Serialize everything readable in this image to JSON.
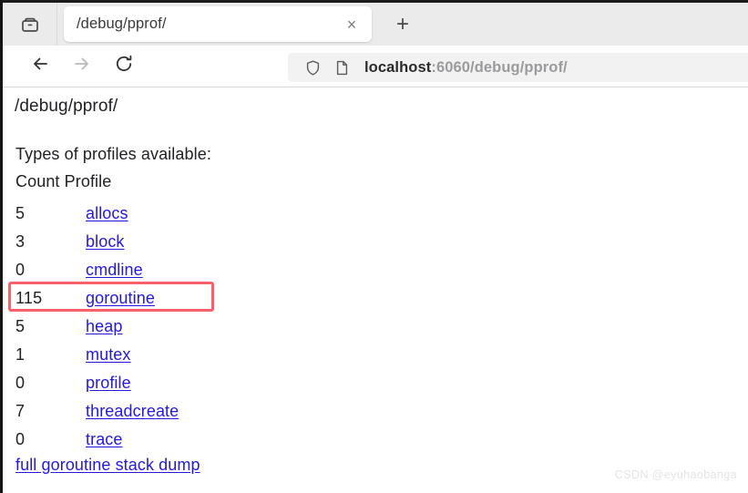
{
  "browser": {
    "tab_bar": {
      "list_all_tabs_icon": "tab-group-icon",
      "tabs": [
        {
          "title": "/debug/pprof/",
          "close_label": "×",
          "active": true
        }
      ],
      "new_tab_label": "+"
    },
    "nav_bar": {
      "back_label": "←",
      "forward_label": "→",
      "reload_label": "⟳",
      "url": {
        "shield_icon": "shield-icon",
        "page_icon": "page-document-icon",
        "host": "localhost",
        "path": ":6060/debug/pprof/"
      }
    }
  },
  "page": {
    "heading": "/debug/pprof/",
    "subtitle": "Types of profiles available:",
    "table": {
      "columns": [
        "Count",
        "Profile"
      ],
      "header_text": "Count Profile",
      "rows": [
        {
          "count": "5",
          "profile": "allocs",
          "highlighted": false
        },
        {
          "count": "3",
          "profile": "block",
          "highlighted": false
        },
        {
          "count": "0",
          "profile": "cmdline",
          "highlighted": false
        },
        {
          "count": "115",
          "profile": "goroutine",
          "highlighted": true
        },
        {
          "count": "5",
          "profile": "heap",
          "highlighted": false
        },
        {
          "count": "1",
          "profile": "mutex",
          "highlighted": false
        },
        {
          "count": "0",
          "profile": "profile",
          "highlighted": false
        },
        {
          "count": "7",
          "profile": "threadcreate",
          "highlighted": false
        },
        {
          "count": "0",
          "profile": "trace",
          "highlighted": false
        }
      ]
    },
    "full_dump_link": "full goroutine stack dump",
    "watermark": "CSDN  @eyuhaobanga"
  },
  "colors": {
    "link": "#2318e0",
    "highlight_border": "#f9606a",
    "tab_bar_bg": "#ebebeb",
    "url_bar_bg": "#f2f2f3",
    "text": "#202124"
  }
}
